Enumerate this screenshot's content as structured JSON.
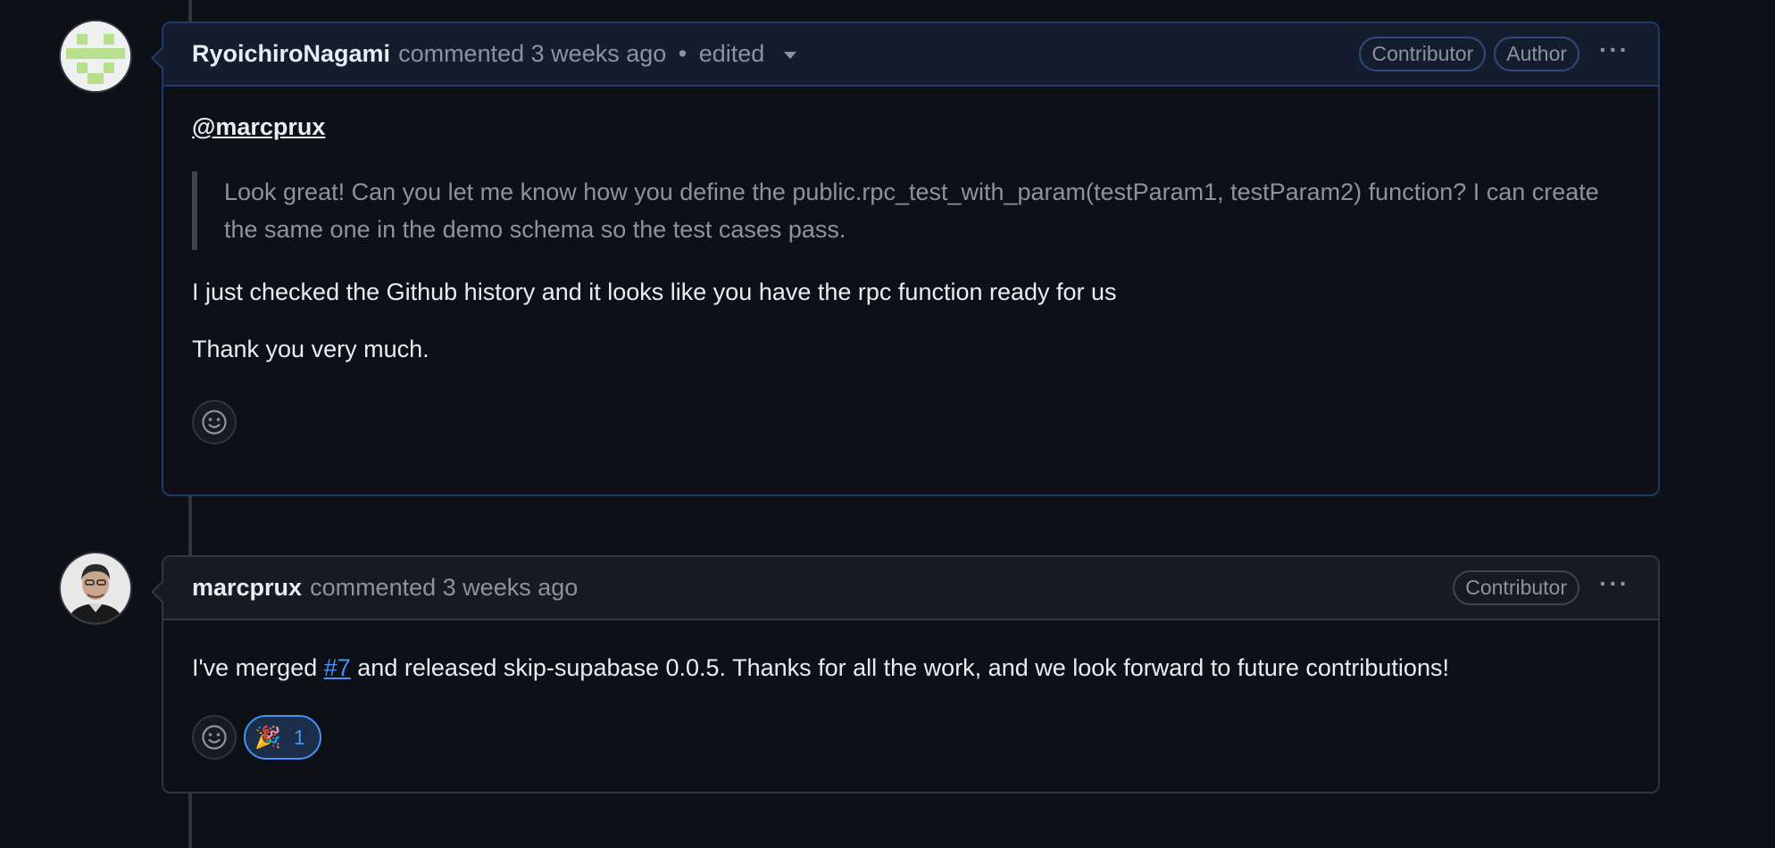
{
  "comments": [
    {
      "author": "RyoichiroNagami",
      "action": "commented",
      "time": "3 weeks ago",
      "edited_sep": "•",
      "edited": "edited",
      "badges": [
        "Contributor",
        "Author"
      ],
      "mention": "@marcprux",
      "quote": "Look great! Can you let me know how you define the public.rpc_test_with_param(testParam1, testParam2) function? I can create the same one in the demo schema so the test cases pass.",
      "paragraphs": [
        "I just checked the Github history and it looks like you have the rpc function ready for us",
        "Thank you very much."
      ]
    },
    {
      "author": "marcprux",
      "action": "commented",
      "time": "3 weeks ago",
      "badges": [
        "Contributor"
      ],
      "body_pre": "I've merged ",
      "body_link": "#7",
      "body_post": " and released skip-supabase 0.0.5. Thanks for all the work, and we look forward to future contributions!",
      "reaction": {
        "emoji": "🎉",
        "count": "1"
      }
    }
  ],
  "icons": {
    "more": "kebab-horizontal-icon",
    "react": "smiley-icon",
    "edited_menu": "triangle-down-icon"
  },
  "colors": {
    "background": "#0d1117",
    "link": "#4493f8",
    "muted": "#8b949e"
  }
}
